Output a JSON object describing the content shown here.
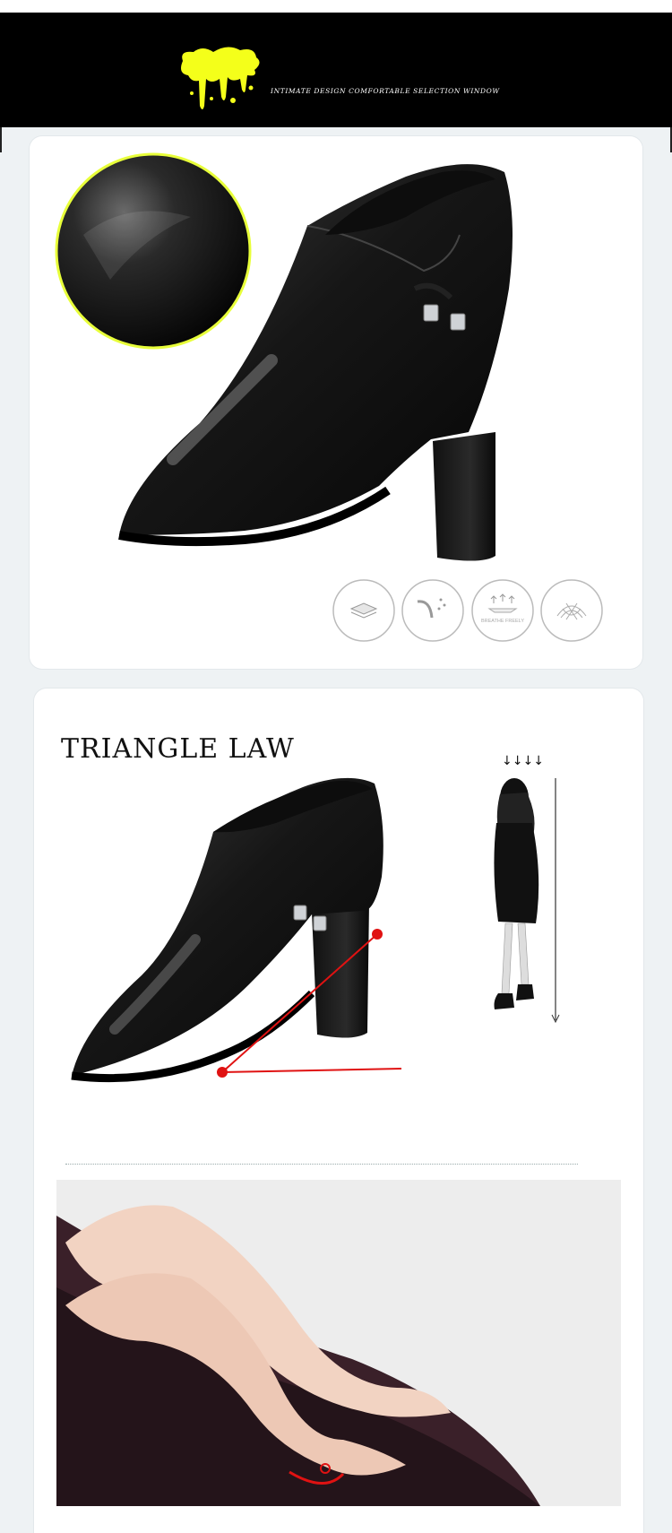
{
  "banner": {
    "tagline": "INTIMATE DESIGN COMFORTABLE SELECTION WINDOW",
    "splash_color": "#f4ff1a",
    "background": "#000000"
  },
  "features": {
    "icons": [
      "layers-icon",
      "flex-icon",
      "breathe-icon",
      "mesh-icon"
    ],
    "breathe_label": "BREATHE FREELY"
  },
  "triangle": {
    "title": "TRIANGLE LAW",
    "arrows": "↓↓↓↓",
    "accent": "#e01212"
  }
}
